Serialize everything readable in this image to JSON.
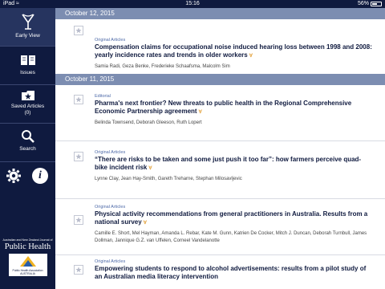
{
  "status": {
    "device": "iPad",
    "time": "15:16",
    "battery": "56%",
    "battery_level": 0.56
  },
  "sidebar": {
    "items": [
      {
        "label": "Early View",
        "icon": "early-view-icon"
      },
      {
        "label": "Issues",
        "icon": "book-icon"
      },
      {
        "label": "Saved Articles\n(0)",
        "icon": "folder-star-icon"
      },
      {
        "label": "Search",
        "icon": "magnifier-icon"
      }
    ],
    "tools": {
      "settings_icon": "gear-icon",
      "info_icon": "info-icon",
      "info_glyph": "i"
    },
    "brand": {
      "journal_top": "Australian and New Zealand Journal of",
      "journal_name": "Public Health",
      "logo_text": "Public Health Association\nAUSTRALIA"
    }
  },
  "feed": {
    "sections": [
      {
        "date": "October 12, 2015",
        "articles": [
          {
            "category": "Original Articles",
            "title": "Compensation claims for occupational noise induced hearing loss between 1998 and 2008: yearly incidence rates and trends in older workers",
            "authors": "Samia Radi, Geza Benke, Frederieke Schaafsma, Malcolm Sim"
          }
        ]
      },
      {
        "date": "October 11, 2015",
        "articles": [
          {
            "category": "Editorial",
            "title": "Pharma's next frontier? New threats to public health in the Regional Comprehensive Economic Partnership agreement",
            "authors": "Belinda Townsend, Deborah Gleeson, Ruth Lopert"
          },
          {
            "category": "Original Articles",
            "title": "“There are risks to be taken and some just push it too far”: how farmers perceive quad-bike incident risk",
            "authors": "Lynne Clay, Jean Hay-Smith, Gareth Treharne, Stephan Milosavljevic"
          },
          {
            "category": "Original Articles",
            "title": "Physical activity recommendations from general practitioners in Australia. Results from a national survey",
            "authors": "Camille E. Short, Mel Hayman, Amanda L. Rebar, Kate M. Gunn, Katrien De Cocker, Mitch J. Duncan, Deborah Turnbull, James Dollman, Jannique G.Z. van Uffelen, Corneel Vandelanotte"
          },
          {
            "category": "Original Articles",
            "title": "Empowering students to respond to alcohol advertisements: results from a pilot study of an Australian media literacy intervention",
            "authors": ""
          }
        ]
      }
    ],
    "lock_icon": "open-access-lock-icon",
    "lock_glyph": "∀"
  }
}
